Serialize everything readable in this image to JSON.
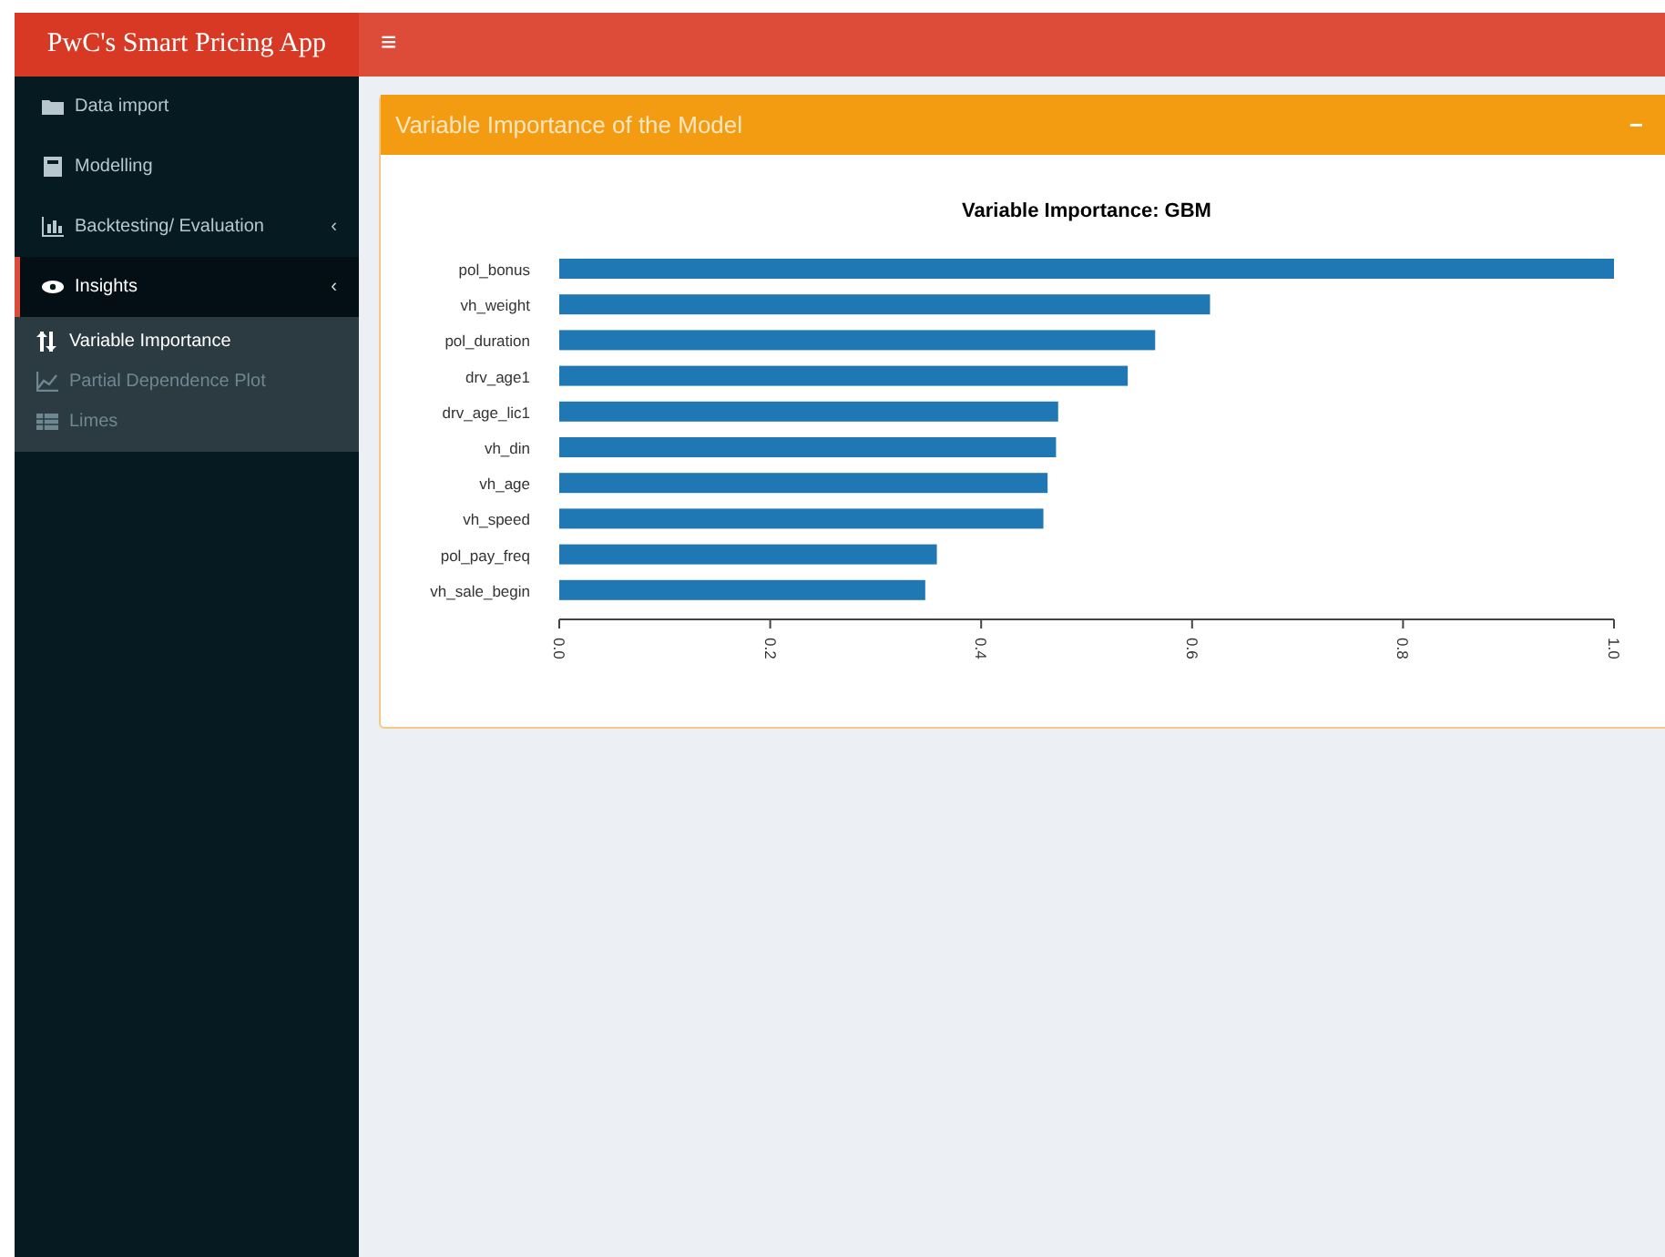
{
  "header": {
    "logo": "PwC's Smart Pricing App",
    "toggle": "≡"
  },
  "sidebar": {
    "items": [
      {
        "label": "Data import",
        "selected": false
      },
      {
        "label": "Modelling",
        "selected": false
      },
      {
        "label": "Backtesting/ Evaluation",
        "selected": false,
        "expanded": false,
        "caret": "‹"
      },
      {
        "label": "Insights",
        "selected": true,
        "expanded": true,
        "caret": "‹",
        "children": [
          {
            "label": "Variable Importance",
            "selected": true
          },
          {
            "label": "Partial Dependence Plot",
            "selected": false
          },
          {
            "label": "Limes",
            "selected": false
          }
        ]
      }
    ]
  },
  "box": {
    "title": "Variable Importance of the Model",
    "collapse": "−",
    "chart_data": {
      "type": "bar",
      "orientation": "horizontal",
      "title": "Variable Importance: GBM",
      "categories": [
        "pol_bonus",
        "vh_weight",
        "pol_duration",
        "drv_age1",
        "drv_age_lic1",
        "vh_din",
        "vh_age",
        "vh_speed",
        "pol_pay_freq",
        "vh_sale_begin"
      ],
      "series": [
        {
          "color": "#1f77b4",
          "values": [
            1.0,
            0.617,
            0.565,
            0.539,
            0.473,
            0.471,
            0.463,
            0.459,
            0.358,
            0.347
          ]
        }
      ],
      "xlim": [
        0,
        1
      ],
      "xticks": [
        {
          "value": 0,
          "label": "0.0"
        },
        {
          "value": 0.2,
          "label": "0.2"
        },
        {
          "value": 0.4,
          "label": "0.4"
        },
        {
          "value": 0.6,
          "label": "0.6"
        },
        {
          "value": 0.8,
          "label": "0.8"
        },
        {
          "value": 1,
          "label": "1.0"
        }
      ]
    }
  }
}
